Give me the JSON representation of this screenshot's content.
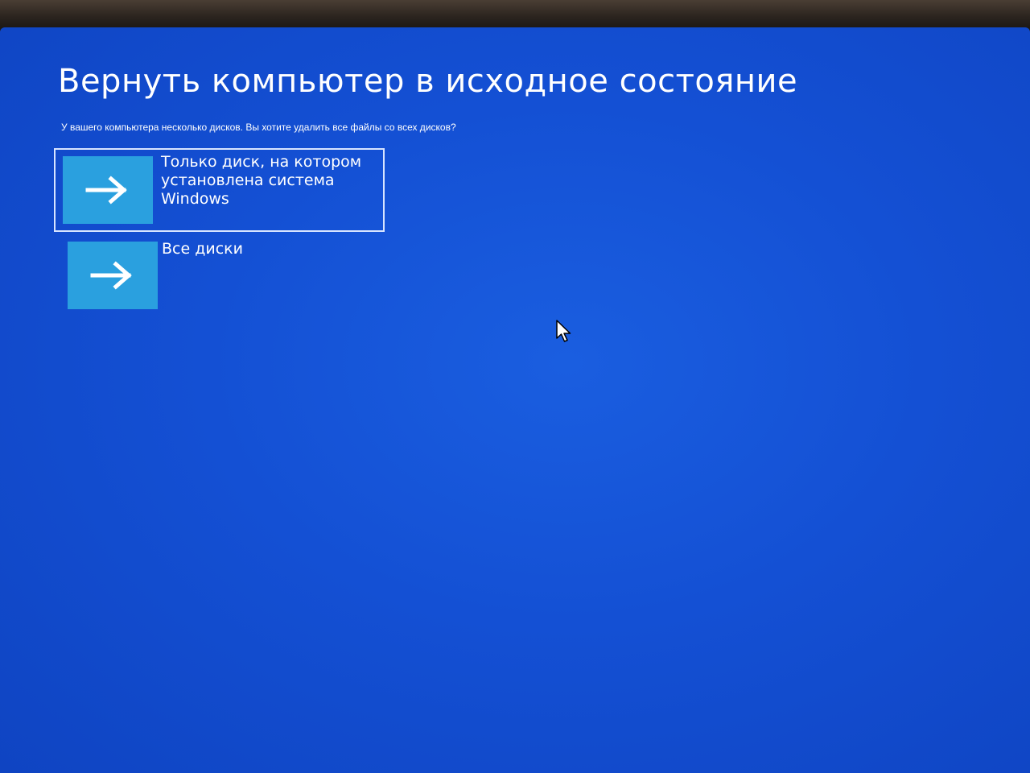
{
  "screen": {
    "title": "Вернуть компьютер в исходное состояние",
    "subtitle": "У вашего компьютера несколько дисков. Вы хотите удалить все файлы со всех дисков?"
  },
  "options": [
    {
      "label": "Только диск, на котором установлена система Windows",
      "icon": "arrow-right-icon",
      "selected": true
    },
    {
      "label": "Все диски",
      "icon": "arrow-right-icon",
      "selected": false
    }
  ],
  "colors": {
    "background": "#1450d4",
    "tile": "#2aa0df",
    "text": "#ffffff",
    "focus_border": "#d7e4ff"
  }
}
